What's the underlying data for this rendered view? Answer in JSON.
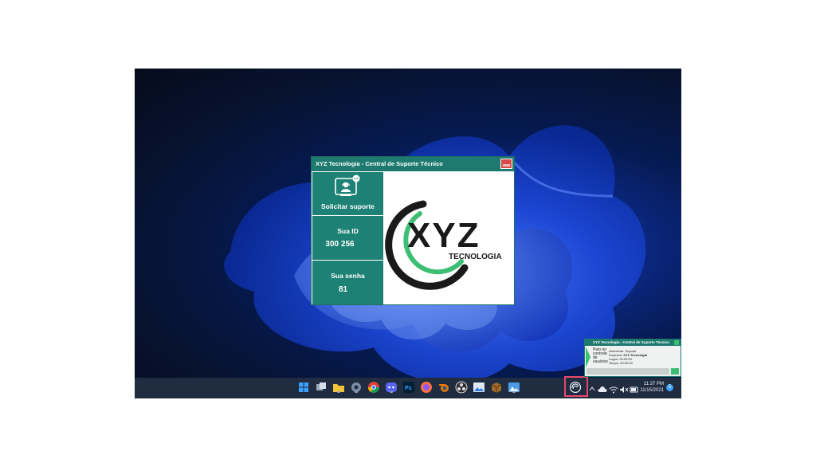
{
  "app_window": {
    "title": "XYZ Tecnologia - Central de Suporte Técnico",
    "request_support_label": "Solicitar suporte",
    "id_label": "Sua ID",
    "id_value": "300 256",
    "password_label": "Sua senha",
    "password_value": "81",
    "logo_text": "XYZ",
    "logo_subtext": "TECNOLOGIA"
  },
  "mini_panel": {
    "title": "XYZ Tecnologia - Central de Suporte Técnico",
    "left_text": [
      "Pelo no",
      "controle",
      "de",
      "usuários"
    ],
    "rows": [
      {
        "label": "Atendente:",
        "value": "Suporte"
      },
      {
        "label": "Empresa:",
        "value": "XYZ Tecnologia"
      },
      {
        "label": "Logon:",
        "value": "00:00:00"
      },
      {
        "label": "Tempo:",
        "value": "00:00:00"
      }
    ]
  },
  "taskbar": {
    "apps": [
      "windows-start",
      "file-explorer",
      "folder",
      "settings",
      "chrome",
      "discord",
      "photoshop",
      "firefox",
      "blender",
      "obs",
      "photos",
      "box-app",
      "image-viewer"
    ],
    "tray": {
      "time": "11:37 PM",
      "date": "11/15/2021",
      "notification_count": "5"
    }
  },
  "colors": {
    "app_green": "#1e7a6f",
    "tile_green": "#1e8175",
    "logo_green": "#3dbf73",
    "close_red": "#d94b4b",
    "highlight_pink": "#e8486b",
    "taskbar": "#202c3f"
  }
}
